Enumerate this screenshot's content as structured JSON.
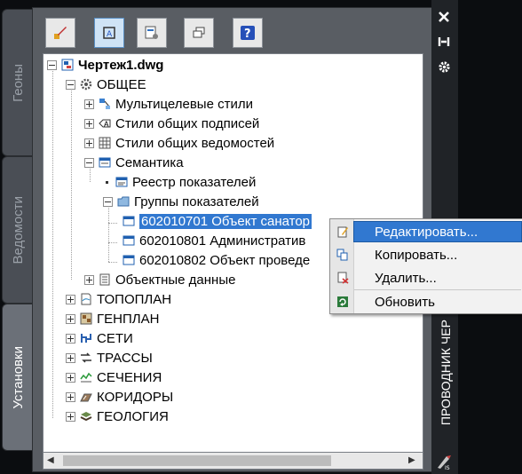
{
  "side_tabs": [
    {
      "label": "Геоны",
      "active": false
    },
    {
      "label": "Ведомости",
      "active": false
    },
    {
      "label": "Установки",
      "active": true
    }
  ],
  "toolbar": {
    "buttons": [
      {
        "icon": "edit-brush-icon",
        "pressed": false
      },
      {
        "icon": "annotation-icon",
        "pressed": true
      },
      {
        "icon": "sheet-settings-icon",
        "pressed": false
      },
      {
        "icon": "windows-icon",
        "pressed": false
      },
      {
        "icon": "help-icon",
        "pressed": false
      }
    ]
  },
  "tree": {
    "root": "Чертеж1.dwg",
    "general": "ОБЩЕЕ",
    "multileader_styles": "Мультицелевые стили",
    "label_styles": "Стили общих подписей",
    "table_styles": "Стили общих ведомостей",
    "semantics": "Семантика",
    "indicator_registry": "Реестр показателей",
    "indicator_groups": "Группы показателей",
    "group_items": [
      "602010701 Объект санатор",
      "602010801 Административ",
      "602010802 Объект проведе"
    ],
    "object_data": "Объектные данные",
    "sections": [
      "ТОПОПЛАН",
      "ГЕНПЛАН",
      "СЕТИ",
      "ТРАССЫ",
      "СЕЧЕНИЯ",
      "КОРИДОРЫ",
      "ГЕОЛОГИЯ"
    ]
  },
  "context_menu": {
    "items": [
      "Редактировать...",
      "Копировать...",
      "Удалить...",
      "Обновить"
    ],
    "highlighted_index": 0
  },
  "right_strip": {
    "title": "ПРОВОДНИК ЧЕР",
    "icons": [
      "close-icon",
      "pin-icon",
      "settings-icon"
    ]
  },
  "colors": {
    "selection": "#3178d0",
    "panel": "#595d63",
    "background": "#0b0d10"
  }
}
